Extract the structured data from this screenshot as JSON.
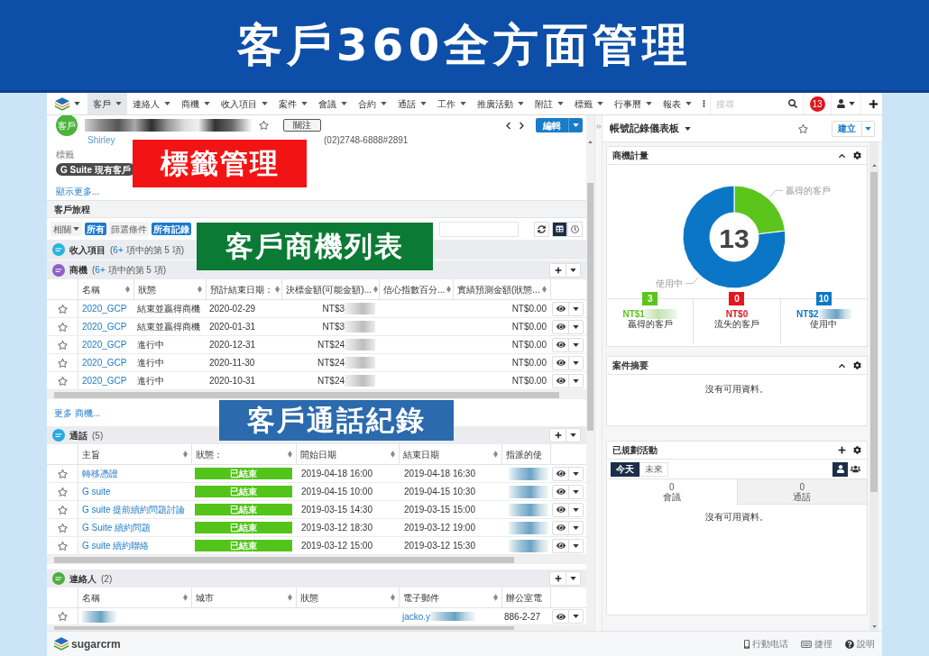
{
  "banner": {
    "title": "客戶360全方面管理"
  },
  "nav": {
    "items": [
      {
        "label": "客戶",
        "selected": true
      },
      {
        "label": "連絡人",
        "selected": false
      },
      {
        "label": "商機",
        "selected": false
      },
      {
        "label": "收入項目",
        "selected": false
      },
      {
        "label": "案件",
        "selected": false
      },
      {
        "label": "會議",
        "selected": false
      },
      {
        "label": "合約",
        "selected": false
      },
      {
        "label": "通話",
        "selected": false
      },
      {
        "label": "工作",
        "selected": false
      },
      {
        "label": "推廣活動",
        "selected": false
      },
      {
        "label": "附註",
        "selected": false
      },
      {
        "label": "標籤",
        "selected": false
      },
      {
        "label": "行事曆",
        "selected": false
      },
      {
        "label": "報表",
        "selected": false
      }
    ],
    "search": {
      "placeholder": "搜尋"
    },
    "notifications": "13"
  },
  "record": {
    "avatar": "客戶",
    "follow_button": "關注",
    "edit_button": "編輯",
    "contact": "Shirley",
    "phone": "(02)2748-6888#2891",
    "tags_label": "標籤",
    "tags": [
      "G Suite 現有客戶"
    ],
    "show_more": "顯示更多..."
  },
  "journey": {
    "title": "客戶旅程",
    "related": "相關",
    "related_value": "所有",
    "filter_label": "篩選條件",
    "filter_value": "所有記錄",
    "views": [
      {
        "kind": "list",
        "selected": true
      },
      {
        "kind": "timeline",
        "selected": false
      }
    ]
  },
  "revenue": {
    "kind": "revenue",
    "title": "收入項目",
    "expanded": false,
    "count_parts": [
      {
        "kind": "text",
        "text": "("
      },
      {
        "kind": "link",
        "text": "6+"
      },
      {
        "kind": "text",
        "text": " 項中的第 5 項)"
      }
    ]
  },
  "opportunities": {
    "kind": "opportunities",
    "title": "商機",
    "expanded": true,
    "count_parts": [
      {
        "kind": "text",
        "text": "("
      },
      {
        "kind": "link",
        "text": "6+"
      },
      {
        "kind": "text",
        "text": " 項中的第 5 項)"
      }
    ],
    "columns": [
      {
        "label": "名稱",
        "sortable": true
      },
      {
        "label": "狀態",
        "sortable": true
      },
      {
        "label": "預計結束日期：",
        "sortable": true
      },
      {
        "label": "決標金額(可能金額)...",
        "sortable": true
      },
      {
        "label": "信心指數百分...",
        "sortable": true
      },
      {
        "label": "實績預測金額(狀態...",
        "sortable": true
      }
    ],
    "rows": [
      {
        "favorite": false,
        "name": "2020_GCP",
        "status": "結束並贏得商機",
        "close_date": "2020-02-29",
        "amount": "NT$3",
        "forecast": "NT$0.00"
      },
      {
        "favorite": false,
        "name": "2020_GCP",
        "status": "結束並贏得商機",
        "close_date": "2020-01-31",
        "amount": "NT$3",
        "forecast": "NT$0.00"
      },
      {
        "favorite": false,
        "name": "2020_GCP",
        "status": "進行中",
        "close_date": "2020-12-31",
        "amount": "NT$24",
        "forecast": "NT$0.00"
      },
      {
        "favorite": false,
        "name": "2020_GCP",
        "status": "進行中",
        "close_date": "2020-11-30",
        "amount": "NT$24",
        "forecast": "NT$0.00"
      },
      {
        "favorite": false,
        "name": "2020_GCP",
        "status": "進行中",
        "close_date": "2020-10-31",
        "amount": "NT$24",
        "forecast": "NT$0.00"
      }
    ],
    "more_link": "更多 商機..."
  },
  "calls": {
    "kind": "calls",
    "title": "通話",
    "expanded": true,
    "count_parts": [
      {
        "kind": "text",
        "text": "(5)"
      }
    ],
    "columns": [
      {
        "label": "主旨",
        "sortable": true
      },
      {
        "label": "狀態：",
        "sortable": true
      },
      {
        "label": "開始日期",
        "sortable": true
      },
      {
        "label": "結束日期",
        "sortable": true
      },
      {
        "label": "指派的使",
        "sortable": false
      }
    ],
    "rows": [
      {
        "favorite": false,
        "subject": "轉移憑證",
        "status": {
          "label": "已結束",
          "kind": "held"
        },
        "start": "2019-04-18 16:00",
        "end": "2019-04-18 16:30"
      },
      {
        "favorite": false,
        "subject": "G suite",
        "status": {
          "label": "已結束",
          "kind": "held"
        },
        "start": "2019-04-15 10:00",
        "end": "2019-04-15 10:30"
      },
      {
        "favorite": false,
        "subject": "G suite 提前續約問題討論",
        "status": {
          "label": "已結束",
          "kind": "held"
        },
        "start": "2019-03-15 14:30",
        "end": "2019-03-15 15:00"
      },
      {
        "favorite": false,
        "subject": "G Suite 續約問題",
        "status": {
          "label": "已結束",
          "kind": "held"
        },
        "start": "2019-03-12 18:30",
        "end": "2019-03-12 19:00"
      },
      {
        "favorite": false,
        "subject": "G suite 續約聯絡",
        "status": {
          "label": "已結束",
          "kind": "held"
        },
        "start": "2019-03-12 15:00",
        "end": "2019-03-12 15:30"
      }
    ]
  },
  "contacts": {
    "kind": "contacts",
    "title": "連絡人",
    "expanded": true,
    "count_parts": [
      {
        "kind": "text",
        "text": "(2)"
      }
    ],
    "columns": [
      {
        "label": "名稱",
        "sortable": true
      },
      {
        "label": "城市",
        "sortable": true
      },
      {
        "label": "狀態",
        "sortable": true
      },
      {
        "label": "電子郵件",
        "sortable": true
      },
      {
        "label": "辦公室電",
        "sortable": false
      }
    ],
    "rows": [
      {
        "favorite": false,
        "email": "jacko.y",
        "office_phone": "886-2-27"
      }
    ]
  },
  "dashboard": {
    "title": "帳號記錄儀表板",
    "create_button": "建立",
    "dashlets": [
      {
        "kind": "chart",
        "title": "商機計量",
        "total": "13",
        "chart_data": {
          "type": "donut",
          "categories": [
            "贏得的客戶",
            "使用中"
          ],
          "values": [
            23.08,
            76.92
          ]
        },
        "stats": [
          {
            "count": "3",
            "amount": "NT$1",
            "masked": true,
            "label": "贏得的客戶",
            "color": "#5bc51c"
          },
          {
            "count": "0",
            "amount": "NT$0",
            "masked": false,
            "label": "流失的客戶",
            "color": "#e3161f"
          },
          {
            "count": "10",
            "amount": "NT$2",
            "masked": true,
            "label": "使用中",
            "color": "#0b79c8"
          }
        ]
      },
      {
        "kind": "empty",
        "title": "案件摘要",
        "message": "沒有可用資料。"
      },
      {
        "kind": "activities",
        "title": "已規劃活動",
        "periods": [
          {
            "label": "今天",
            "selected": true
          },
          {
            "label": "未來",
            "selected": false
          }
        ],
        "scopes": [
          {
            "kind": "user",
            "selected": true
          },
          {
            "kind": "group",
            "selected": false
          }
        ],
        "tabs": [
          {
            "count": "0",
            "label": "會議",
            "selected": true
          },
          {
            "count": "0",
            "label": "通話",
            "selected": false
          }
        ],
        "message": "沒有可用資料。"
      }
    ]
  },
  "footer": {
    "logo": "sugarcrm",
    "links": [
      {
        "kind": "mobile",
        "label": "行動电话"
      },
      {
        "kind": "shortcuts",
        "label": "捷徑"
      },
      {
        "kind": "help",
        "label": "說明"
      }
    ]
  },
  "annotations": [
    {
      "text": "標籤管理",
      "color": "#f21414"
    },
    {
      "text": "客戶商機列表",
      "color": "#0b7a34"
    },
    {
      "text": "客戶通話紀錄",
      "color": "#2a6aad"
    }
  ]
}
